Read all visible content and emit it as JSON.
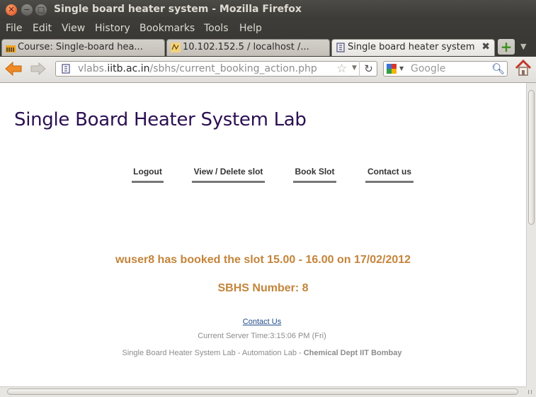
{
  "window": {
    "title": "Single board heater system - Mozilla Firefox"
  },
  "menu": [
    "File",
    "Edit",
    "View",
    "History",
    "Bookmarks",
    "Tools",
    "Help"
  ],
  "tabs": [
    {
      "label": "Course: Single-board hea...",
      "icon": "moodle-icon"
    },
    {
      "label": "10.102.152.5 / localhost /...",
      "icon": "phpmyadmin-icon"
    },
    {
      "label": "Single board heater system",
      "icon": "site-icon",
      "active": true
    }
  ],
  "url": {
    "domain_pre": "vlabs.",
    "domain": "iitb.ac.in",
    "path": "/sbhs/current_booking_action.php"
  },
  "search": {
    "placeholder": "Google"
  },
  "page": {
    "heading": "Single Board Heater System Lab",
    "nav": [
      "Logout",
      "View / Delete slot",
      "Book Slot",
      "Contact us"
    ],
    "message": "wuser8 has booked the slot 15.00 - 16.00 on 17/02/2012",
    "sbhs": "SBHS Number: 8",
    "footer_link": "Contact Us",
    "server_time": "Current Server Time:3:15:06 PM (Fri)",
    "footer_text": "Single Board Heater System Lab - Automation Lab - ",
    "footer_bold": "Chemical Dept IIT Bombay"
  },
  "colors": {
    "heading": "#2b0f52",
    "message": "#c4843a",
    "link": "#1f4b8a"
  }
}
